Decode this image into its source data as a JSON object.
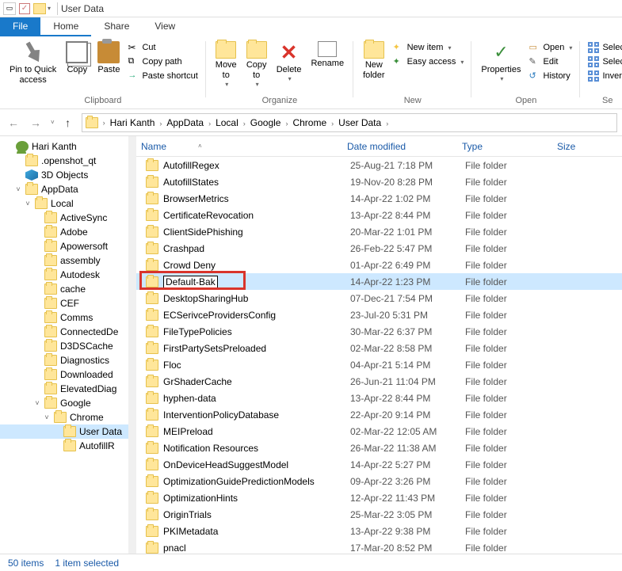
{
  "title": "User Data",
  "menu": {
    "file": "File",
    "home": "Home",
    "share": "Share",
    "view": "View"
  },
  "ribbon": {
    "clipboard": {
      "label": "Clipboard",
      "pin": "Pin to Quick\naccess",
      "copy": "Copy",
      "paste": "Paste",
      "cut": "Cut",
      "copypath": "Copy path",
      "pasteshortcut": "Paste shortcut"
    },
    "organize": {
      "label": "Organize",
      "moveto": "Move\nto",
      "copyto": "Copy\nto",
      "delete": "Delete",
      "rename": "Rename"
    },
    "new": {
      "label": "New",
      "newfolder": "New\nfolder",
      "newitem": "New item",
      "easyaccess": "Easy access"
    },
    "open": {
      "label": "Open",
      "properties": "Properties",
      "open": "Open",
      "edit": "Edit",
      "history": "History"
    },
    "select": {
      "label": "Se",
      "selectall": "Select",
      "selectnone": "Select",
      "invert": "Invert"
    }
  },
  "breadcrumb": [
    "Hari Kanth",
    "AppData",
    "Local",
    "Google",
    "Chrome",
    "User Data"
  ],
  "tree": [
    {
      "lvl": 0,
      "label": "Hari Kanth",
      "icon": "user"
    },
    {
      "lvl": 1,
      "label": ".openshot_qt",
      "icon": "folder"
    },
    {
      "lvl": 1,
      "label": "3D Objects",
      "icon": "cube"
    },
    {
      "lvl": 1,
      "label": "AppData",
      "icon": "folder",
      "exp": "v"
    },
    {
      "lvl": 2,
      "label": "Local",
      "icon": "folder",
      "exp": "v"
    },
    {
      "lvl": 3,
      "label": "ActiveSync",
      "icon": "folder"
    },
    {
      "lvl": 3,
      "label": "Adobe",
      "icon": "folder"
    },
    {
      "lvl": 3,
      "label": "Apowersoft",
      "icon": "folder"
    },
    {
      "lvl": 3,
      "label": "assembly",
      "icon": "folder"
    },
    {
      "lvl": 3,
      "label": "Autodesk",
      "icon": "folder"
    },
    {
      "lvl": 3,
      "label": "cache",
      "icon": "folder"
    },
    {
      "lvl": 3,
      "label": "CEF",
      "icon": "folder"
    },
    {
      "lvl": 3,
      "label": "Comms",
      "icon": "folder"
    },
    {
      "lvl": 3,
      "label": "ConnectedDe",
      "icon": "folder"
    },
    {
      "lvl": 3,
      "label": "D3DSCache",
      "icon": "folder"
    },
    {
      "lvl": 3,
      "label": "Diagnostics",
      "icon": "folder"
    },
    {
      "lvl": 3,
      "label": "Downloaded",
      "icon": "folder"
    },
    {
      "lvl": 3,
      "label": "ElevatedDiag",
      "icon": "folder"
    },
    {
      "lvl": 3,
      "label": "Google",
      "icon": "folder",
      "exp": "v"
    },
    {
      "lvl": 4,
      "label": "Chrome",
      "icon": "folder",
      "exp": "v"
    },
    {
      "lvl": 5,
      "label": "User Data",
      "icon": "folder",
      "sel": true
    },
    {
      "lvl": 5,
      "label": "AutofillR",
      "icon": "folder"
    }
  ],
  "cols": {
    "name": "Name",
    "date": "Date modified",
    "type": "Type",
    "size": "Size"
  },
  "files": [
    {
      "name": "AutofillRegex",
      "date": "25-Aug-21 7:18 PM",
      "type": "File folder"
    },
    {
      "name": "AutofillStates",
      "date": "19-Nov-20 8:28 PM",
      "type": "File folder"
    },
    {
      "name": "BrowserMetrics",
      "date": "14-Apr-22 1:02 PM",
      "type": "File folder"
    },
    {
      "name": "CertificateRevocation",
      "date": "13-Apr-22 8:44 PM",
      "type": "File folder"
    },
    {
      "name": "ClientSidePhishing",
      "date": "20-Mar-22 1:01 PM",
      "type": "File folder"
    },
    {
      "name": "Crashpad",
      "date": "26-Feb-22 5:47 PM",
      "type": "File folder"
    },
    {
      "name": "Crowd Deny",
      "date": "01-Apr-22 6:49 PM",
      "type": "File folder"
    },
    {
      "name": "Default-Bak",
      "date": "14-Apr-22 1:23 PM",
      "type": "File folder",
      "sel": true,
      "rename": true
    },
    {
      "name": "DesktopSharingHub",
      "date": "07-Dec-21 7:54 PM",
      "type": "File folder"
    },
    {
      "name": "ECSerivceProvidersConfig",
      "date": "23-Jul-20 5:31 PM",
      "type": "File folder"
    },
    {
      "name": "FileTypePolicies",
      "date": "30-Mar-22 6:37 PM",
      "type": "File folder"
    },
    {
      "name": "FirstPartySetsPreloaded",
      "date": "02-Mar-22 8:58 PM",
      "type": "File folder"
    },
    {
      "name": "Floc",
      "date": "04-Apr-21 5:14 PM",
      "type": "File folder"
    },
    {
      "name": "GrShaderCache",
      "date": "26-Jun-21 11:04 PM",
      "type": "File folder"
    },
    {
      "name": "hyphen-data",
      "date": "13-Apr-22 8:44 PM",
      "type": "File folder"
    },
    {
      "name": "InterventionPolicyDatabase",
      "date": "22-Apr-20 9:14 PM",
      "type": "File folder"
    },
    {
      "name": "MEIPreload",
      "date": "02-Mar-22 12:05 AM",
      "type": "File folder"
    },
    {
      "name": "Notification Resources",
      "date": "26-Mar-22 11:38 AM",
      "type": "File folder"
    },
    {
      "name": "OnDeviceHeadSuggestModel",
      "date": "14-Apr-22 5:27 PM",
      "type": "File folder"
    },
    {
      "name": "OptimizationGuidePredictionModels",
      "date": "09-Apr-22 3:26 PM",
      "type": "File folder"
    },
    {
      "name": "OptimizationHints",
      "date": "12-Apr-22 11:43 PM",
      "type": "File folder"
    },
    {
      "name": "OriginTrials",
      "date": "25-Mar-22 3:05 PM",
      "type": "File folder"
    },
    {
      "name": "PKIMetadata",
      "date": "13-Apr-22 9:38 PM",
      "type": "File folder"
    },
    {
      "name": "pnacl",
      "date": "17-Mar-20 8:52 PM",
      "type": "File folder"
    }
  ],
  "status": {
    "count": "50 items",
    "selected": "1 item selected"
  }
}
